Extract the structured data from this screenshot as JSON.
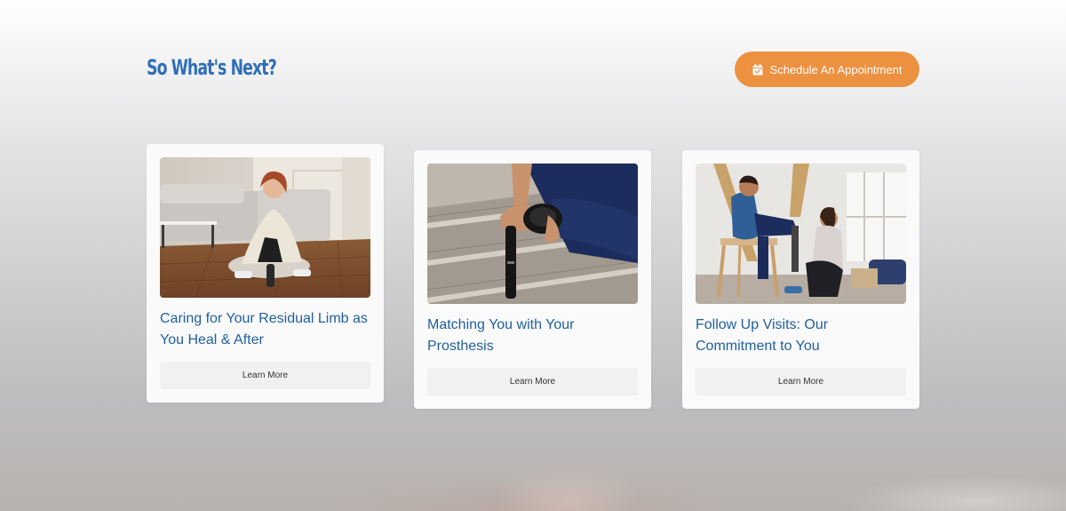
{
  "section": {
    "heading": "So What's Next?",
    "cta_label": "Schedule An Appointment",
    "cta_icon": "calendar-check-icon"
  },
  "colors": {
    "heading": "#2f6fb8",
    "cta_background": "#ec9140",
    "card_title": "#1f5f9e",
    "card_background": "#fafafa",
    "button_background": "#f0f1f1"
  },
  "cards": [
    {
      "title": "Caring for Your Residual Limb as You Heal & After",
      "button_label": "Learn More",
      "image_alt": "Woman with prosthetic leg sitting on wooden floor"
    },
    {
      "title": "Matching You with Your Prosthesis",
      "button_label": "Learn More",
      "image_alt": "Person holding prosthetic leg on wooden steps"
    },
    {
      "title": "Follow Up Visits: Our Commitment to You",
      "button_label": "Learn More",
      "image_alt": "Clinician assisting man with prosthetic leg"
    }
  ]
}
